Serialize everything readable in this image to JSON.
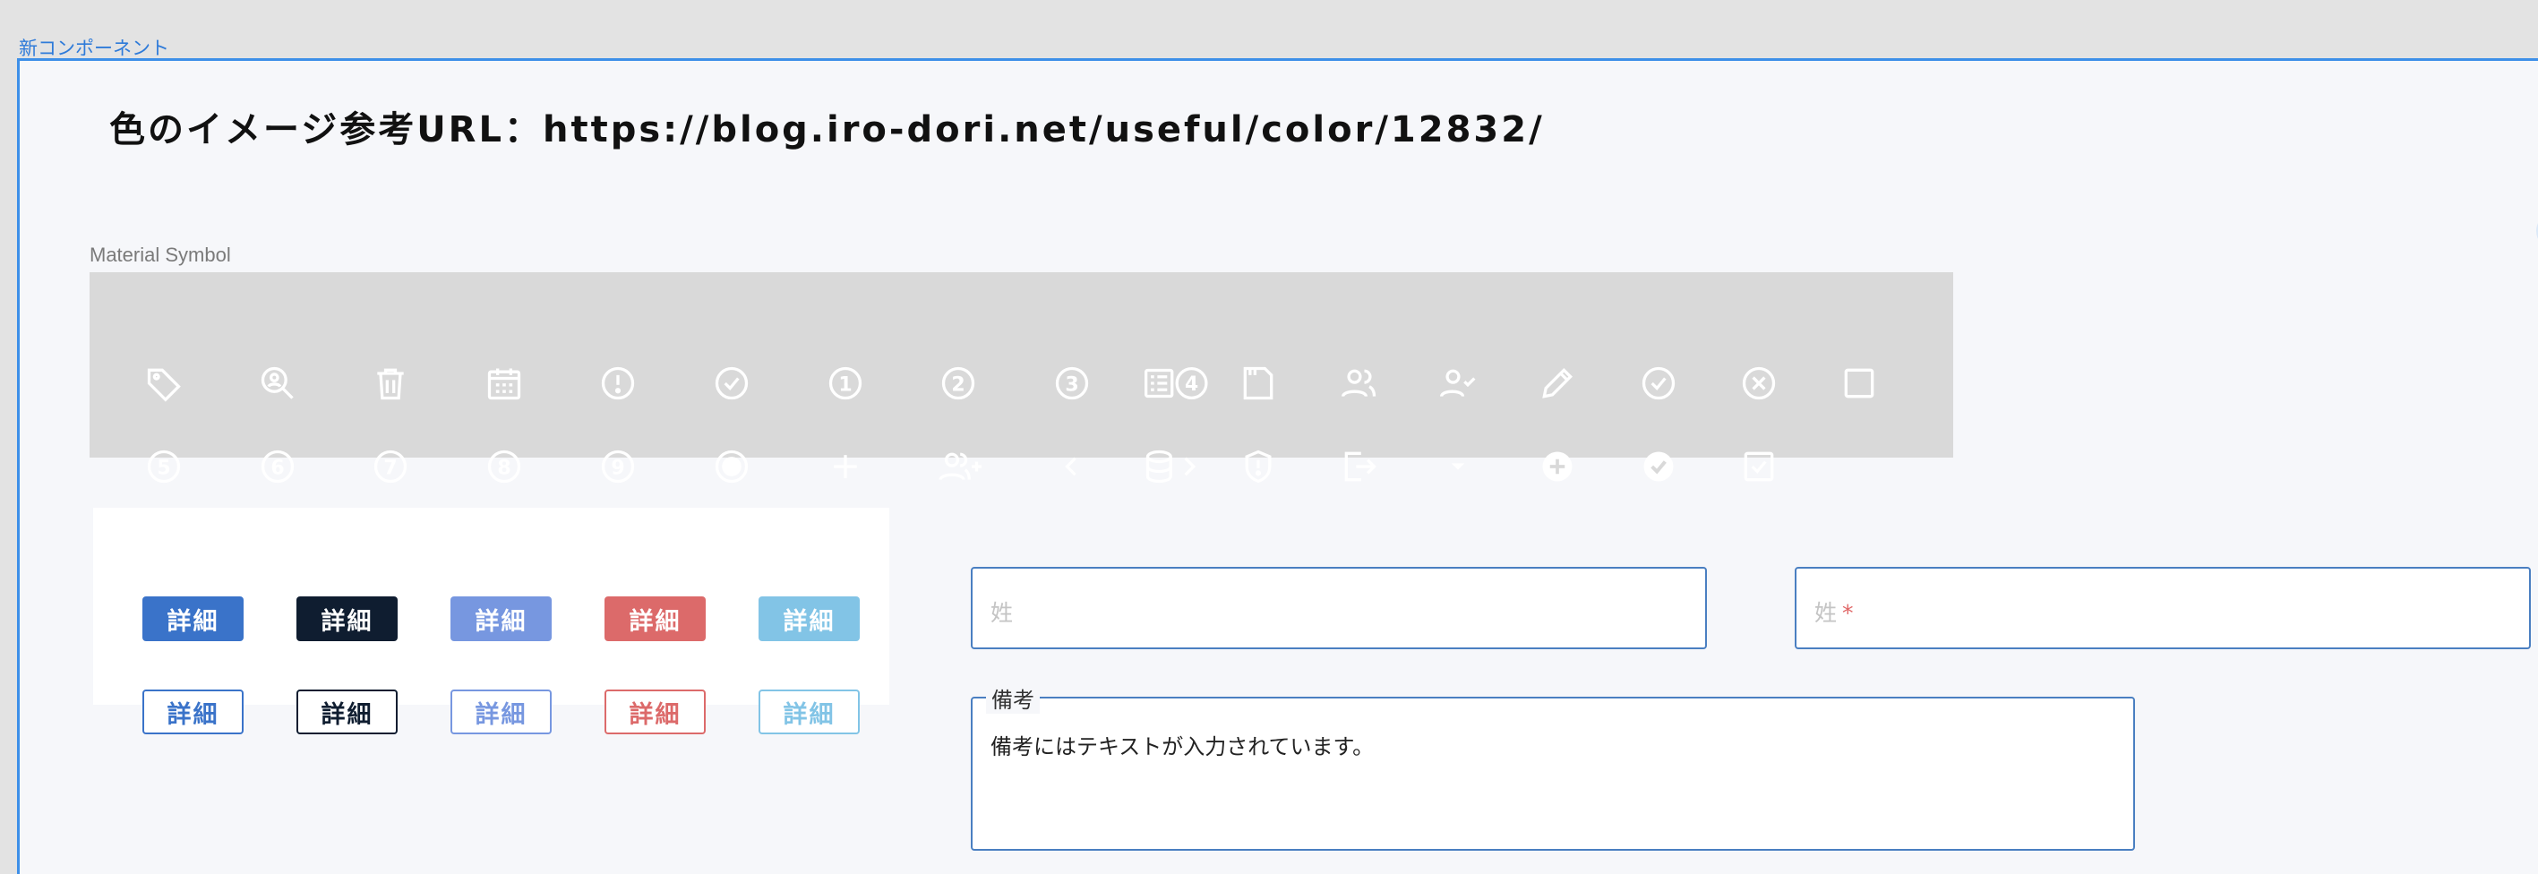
{
  "frame": {
    "label": "新コンポーネント"
  },
  "page": {
    "title": "色のイメージ参考URL：https://blog.iro-dori.net/useful/color/12832/"
  },
  "icon_section": {
    "label": "Material Symbol",
    "row1": [
      "tag-icon",
      "search-person-icon",
      "trash-icon",
      "calendar-icon",
      "alert-circle-icon",
      "check-circle-icon",
      "number-1-icon",
      "number-2-icon",
      "number-3-icon",
      "list-number-4-icon",
      "document-icon",
      "group-icon",
      "person-check-icon",
      "pencil-icon",
      "check-circle-outline-icon",
      "close-circle-icon",
      "checkbox-empty-icon"
    ],
    "row2": [
      "number-5-icon",
      "number-6-icon",
      "number-7-icon",
      "number-8-icon",
      "number-9-icon",
      "radio-filled-icon",
      "plus-icon",
      "add-group-icon",
      "chevron-left-icon",
      "database-arrow-icon",
      "shield-icon",
      "logout-icon",
      "dropdown-caret-icon",
      "add-circle-filled-icon",
      "check-circle-filled-icon",
      "checkbox-checked-icon"
    ]
  },
  "buttons": {
    "label": "詳細",
    "colors": [
      "#3a73c9",
      "#0f1d30",
      "#7797e0",
      "#dc6a6a",
      "#82c4e6"
    ]
  },
  "form": {
    "last_name_placeholder": "姓",
    "last_name_required_placeholder": "姓",
    "required_mark": "*",
    "remarks_label": "備考",
    "remarks_value": "備考にはテキストが入力されています。"
  }
}
